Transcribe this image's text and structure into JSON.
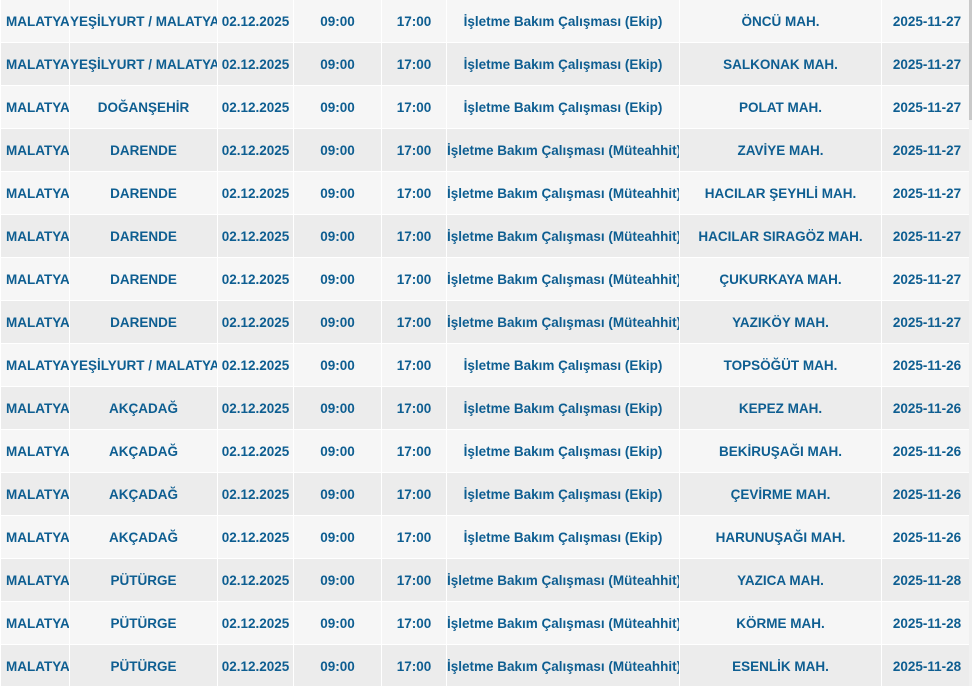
{
  "table": {
    "rows": [
      {
        "city": "MALATYA",
        "district": "YEŞİLYURT / MALATYA",
        "date": "02.12.2025",
        "start": "09:00",
        "end": "17:00",
        "work": "İşletme Bakım Çalışması (Ekip)",
        "neighborhood": "ÖNCÜ MAH.",
        "created": "2025-11-27"
      },
      {
        "city": "MALATYA",
        "district": "YEŞİLYURT / MALATYA",
        "date": "02.12.2025",
        "start": "09:00",
        "end": "17:00",
        "work": "İşletme Bakım Çalışması (Ekip)",
        "neighborhood": "SALKONAK MAH.",
        "created": "2025-11-27"
      },
      {
        "city": "MALATYA",
        "district": "DOĞANŞEHİR",
        "date": "02.12.2025",
        "start": "09:00",
        "end": "17:00",
        "work": "İşletme Bakım Çalışması (Ekip)",
        "neighborhood": "POLAT MAH.",
        "created": "2025-11-27"
      },
      {
        "city": "MALATYA",
        "district": "DARENDE",
        "date": "02.12.2025",
        "start": "09:00",
        "end": "17:00",
        "work": "İşletme Bakım Çalışması (Müteahhit)",
        "neighborhood": "ZAVİYE MAH.",
        "created": "2025-11-27"
      },
      {
        "city": "MALATYA",
        "district": "DARENDE",
        "date": "02.12.2025",
        "start": "09:00",
        "end": "17:00",
        "work": "İşletme Bakım Çalışması (Müteahhit)",
        "neighborhood": "HACILAR ŞEYHLİ MAH.",
        "created": "2025-11-27"
      },
      {
        "city": "MALATYA",
        "district": "DARENDE",
        "date": "02.12.2025",
        "start": "09:00",
        "end": "17:00",
        "work": "İşletme Bakım Çalışması (Müteahhit)",
        "neighborhood": "HACILAR SIRAGÖZ MAH.",
        "created": "2025-11-27"
      },
      {
        "city": "MALATYA",
        "district": "DARENDE",
        "date": "02.12.2025",
        "start": "09:00",
        "end": "17:00",
        "work": "İşletme Bakım Çalışması (Müteahhit)",
        "neighborhood": "ÇUKURKAYA MAH.",
        "created": "2025-11-27"
      },
      {
        "city": "MALATYA",
        "district": "DARENDE",
        "date": "02.12.2025",
        "start": "09:00",
        "end": "17:00",
        "work": "İşletme Bakım Çalışması (Müteahhit)",
        "neighborhood": "YAZIKÖY MAH.",
        "created": "2025-11-27"
      },
      {
        "city": "MALATYA",
        "district": "YEŞİLYURT / MALATYA",
        "date": "02.12.2025",
        "start": "09:00",
        "end": "17:00",
        "work": "İşletme Bakım Çalışması (Ekip)",
        "neighborhood": "TOPSÖĞÜT MAH.",
        "created": "2025-11-26"
      },
      {
        "city": "MALATYA",
        "district": "AKÇADAĞ",
        "date": "02.12.2025",
        "start": "09:00",
        "end": "17:00",
        "work": "İşletme Bakım Çalışması (Ekip)",
        "neighborhood": "KEPEZ MAH.",
        "created": "2025-11-26"
      },
      {
        "city": "MALATYA",
        "district": "AKÇADAĞ",
        "date": "02.12.2025",
        "start": "09:00",
        "end": "17:00",
        "work": "İşletme Bakım Çalışması (Ekip)",
        "neighborhood": "BEKİRUŞAĞI MAH.",
        "created": "2025-11-26"
      },
      {
        "city": "MALATYA",
        "district": "AKÇADAĞ",
        "date": "02.12.2025",
        "start": "09:00",
        "end": "17:00",
        "work": "İşletme Bakım Çalışması (Ekip)",
        "neighborhood": "ÇEVİRME MAH.",
        "created": "2025-11-26"
      },
      {
        "city": "MALATYA",
        "district": "AKÇADAĞ",
        "date": "02.12.2025",
        "start": "09:00",
        "end": "17:00",
        "work": "İşletme Bakım Çalışması (Ekip)",
        "neighborhood": "HARUNUŞAĞI MAH.",
        "created": "2025-11-26"
      },
      {
        "city": "MALATYA",
        "district": "PÜTÜRGE",
        "date": "02.12.2025",
        "start": "09:00",
        "end": "17:00",
        "work": "İşletme Bakım Çalışması (Müteahhit)",
        "neighborhood": "YAZICA MAH.",
        "created": "2025-11-28"
      },
      {
        "city": "MALATYA",
        "district": "PÜTÜRGE",
        "date": "02.12.2025",
        "start": "09:00",
        "end": "17:00",
        "work": "İşletme Bakım Çalışması (Müteahhit)",
        "neighborhood": "KÖRME MAH.",
        "created": "2025-11-28"
      },
      {
        "city": "MALATYA",
        "district": "PÜTÜRGE",
        "date": "02.12.2025",
        "start": "09:00",
        "end": "17:00",
        "work": "İşletme Bakım Çalışması (Müteahhit)",
        "neighborhood": "ESENLİK MAH.",
        "created": "2025-11-28"
      }
    ]
  },
  "colors": {
    "text": "#0e5e91",
    "row_light": "#f6f6f6",
    "row_dark": "#ececec"
  }
}
